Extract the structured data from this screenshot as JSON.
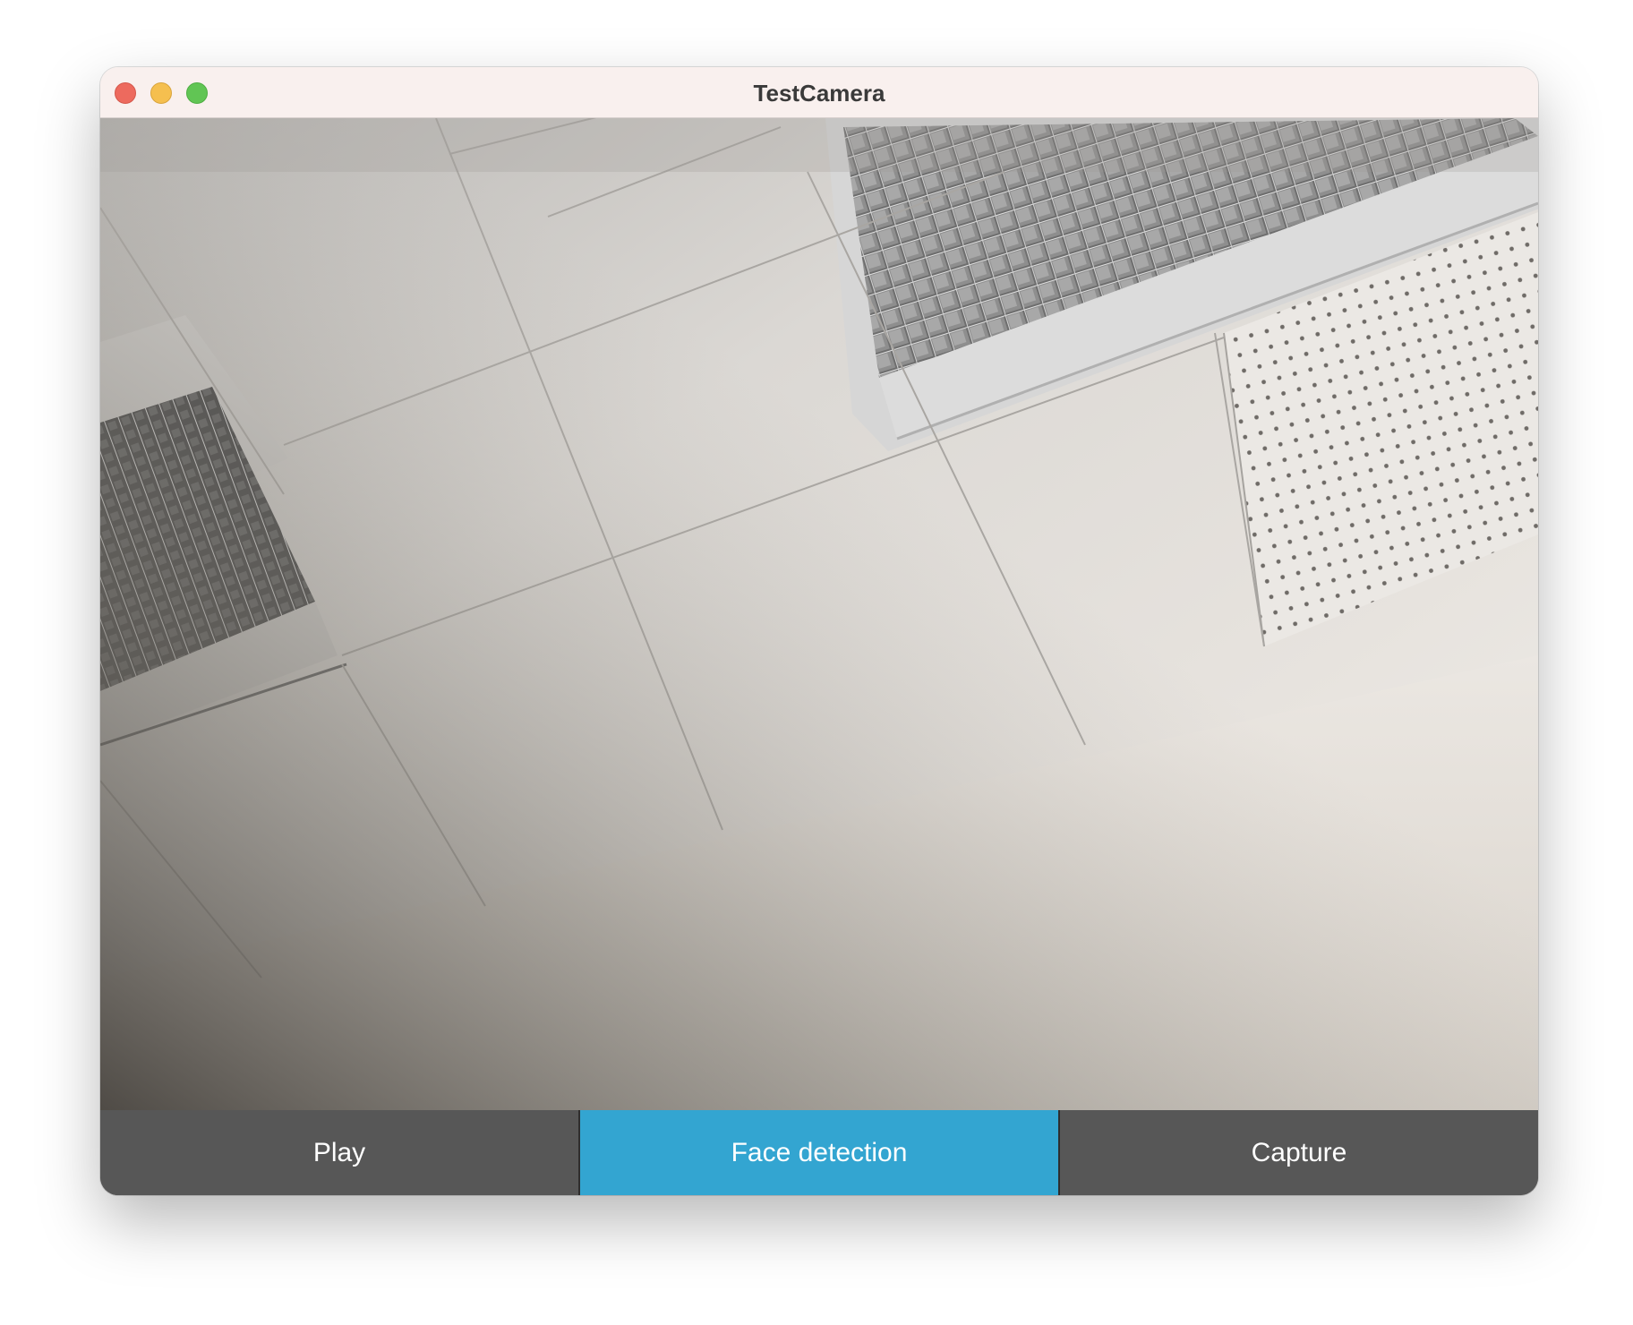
{
  "window": {
    "title": "TestCamera",
    "traffic_lights": [
      "close",
      "minimize",
      "zoom"
    ]
  },
  "camera_view": {
    "content": "live-camera-feed",
    "icon": "camera-feed"
  },
  "buttons": [
    {
      "label": "Play",
      "active": false
    },
    {
      "label": "Face detection",
      "active": true
    },
    {
      "label": "Capture",
      "active": false
    }
  ],
  "colors": {
    "active_button": "#33a5d1",
    "inactive_button": "#575757",
    "titlebar": "#f9f0ee"
  }
}
